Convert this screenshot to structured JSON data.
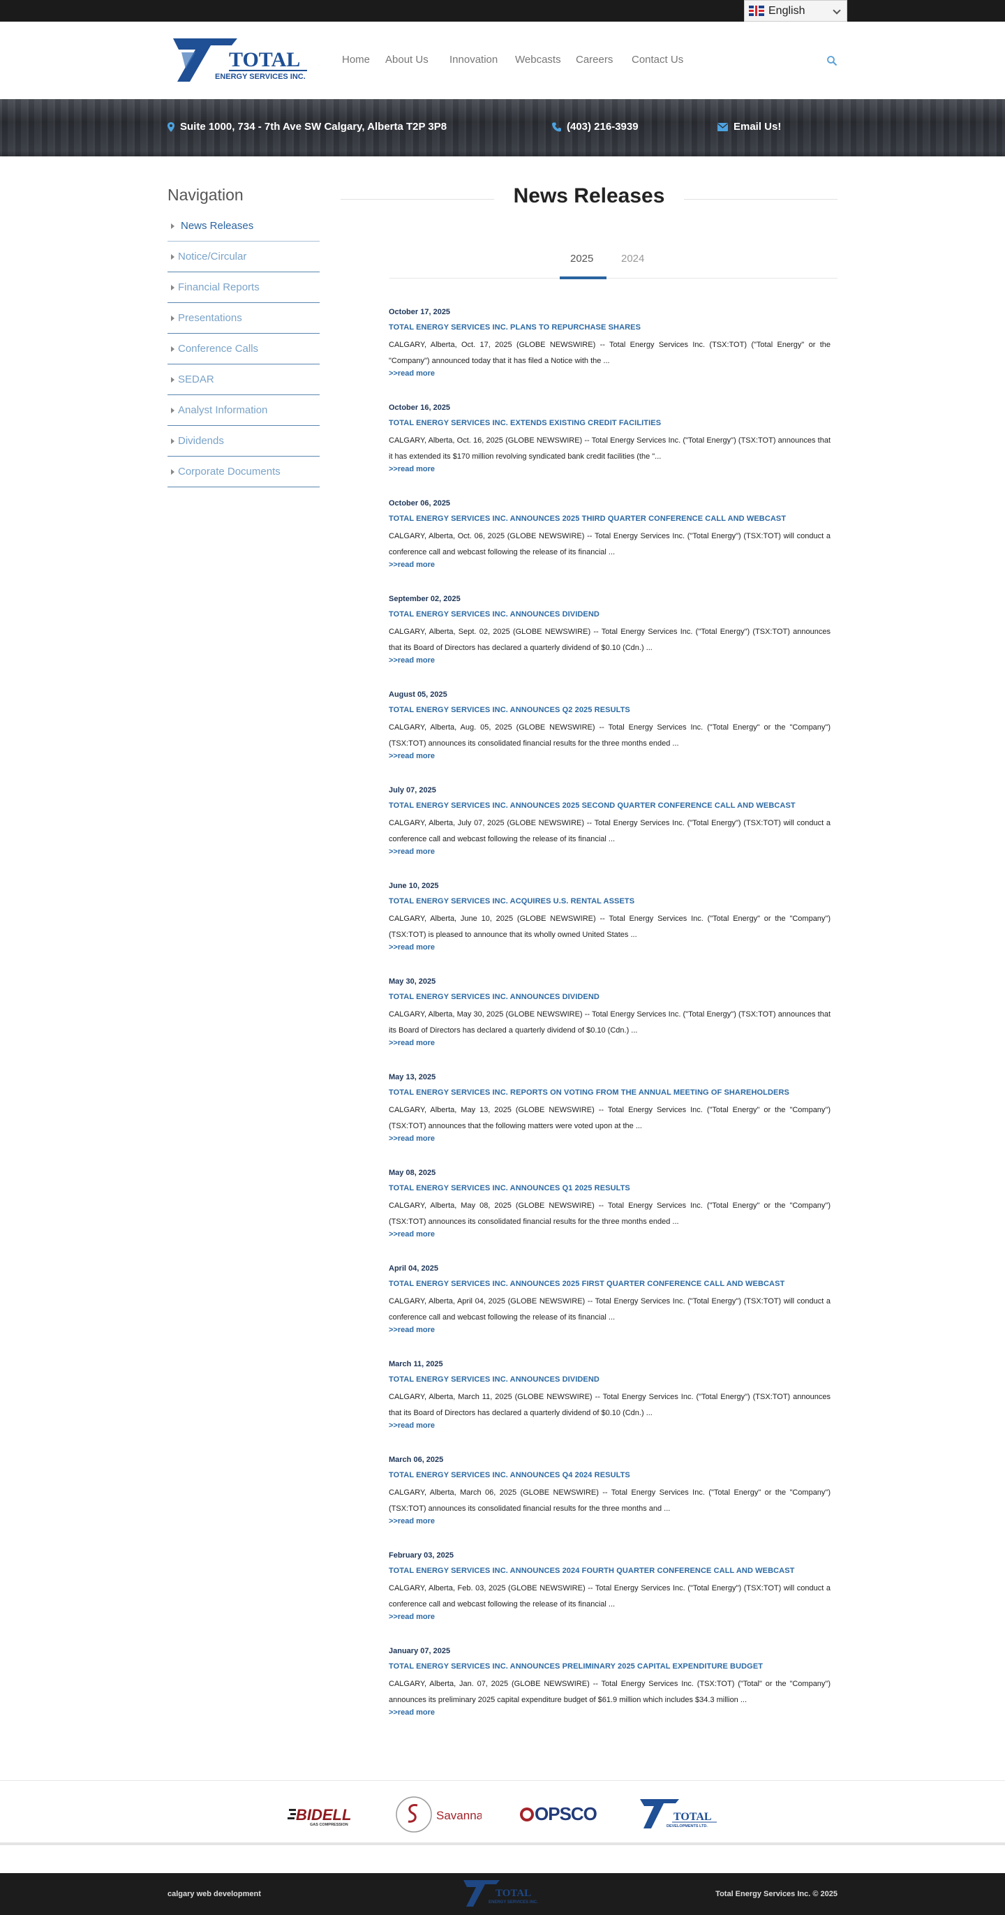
{
  "language_selector": {
    "label": "English",
    "flag_icon": "uk-flag-icon"
  },
  "header": {
    "logo_text": "TOTAL",
    "logo_subtext": "ENERGY SERVICES INC.",
    "nav": [
      "Home",
      "About Us",
      "Innovation",
      "Webcasts",
      "Careers",
      "Contact Us"
    ],
    "search_icon": "search-icon"
  },
  "contact": {
    "address": "Suite 1000, 734 - 7th Ave SW Calgary, Alberta T2P 3P8",
    "phone": "(403) 216-3939",
    "email_label": "Email Us!"
  },
  "sidebar": {
    "title": "Navigation",
    "items": [
      "News Releases",
      "Notice/Circular",
      "Financial Reports",
      "Presentations",
      "Conference Calls",
      "SEDAR",
      "Analyst Information",
      "Dividends",
      "Corporate Documents"
    ],
    "active_index": 0
  },
  "main": {
    "title": "News Releases",
    "tabs": [
      "2025",
      "2024"
    ],
    "active_tab": 0,
    "read_more_label": ">>read more",
    "news": [
      {
        "date": "October 17, 2025",
        "title": "TOTAL ENERGY SERVICES INC. PLANS TO REPURCHASE SHARES",
        "body": "CALGARY, Alberta, Oct. 17, 2025 (GLOBE NEWSWIRE) -- Total Energy Services Inc. (TSX:TOT) (\"Total Energy\" or the \"Company\") announced today that it has filed a Notice with the ..."
      },
      {
        "date": "October 16, 2025",
        "title": "TOTAL ENERGY SERVICES INC. EXTENDS EXISTING CREDIT FACILITIES",
        "body": "CALGARY, Alberta, Oct. 16, 2025 (GLOBE NEWSWIRE) -- Total Energy Services Inc. (\"Total Energy\") (TSX:TOT) announces that it has extended its $170 million revolving syndicated bank credit facilities (the \"..."
      },
      {
        "date": "October 06, 2025",
        "title": "TOTAL ENERGY SERVICES INC. ANNOUNCES 2025 THIRD QUARTER CONFERENCE CALL AND WEBCAST",
        "body": "CALGARY, Alberta, Oct. 06, 2025 (GLOBE NEWSWIRE) -- Total Energy Services Inc. (\"Total Energy\") (TSX:TOT) will conduct a conference call and webcast following the release of its financial ..."
      },
      {
        "date": "September 02, 2025",
        "title": "TOTAL ENERGY SERVICES INC. ANNOUNCES DIVIDEND",
        "body": "CALGARY, Alberta, Sept. 02, 2025 (GLOBE NEWSWIRE) -- Total Energy Services Inc. (\"Total Energy\") (TSX:TOT) announces that its Board of Directors has declared a quarterly dividend of $0.10 (Cdn.) ..."
      },
      {
        "date": "August 05, 2025",
        "title": "TOTAL ENERGY SERVICES INC. ANNOUNCES Q2 2025 RESULTS",
        "body": "CALGARY, Alberta, Aug. 05, 2025 (GLOBE NEWSWIRE) -- Total Energy Services Inc. (\"Total Energy\" or the \"Company\") (TSX:TOT) announces its consolidated financial results for the three months ended ..."
      },
      {
        "date": "July 07, 2025",
        "title": "TOTAL ENERGY SERVICES INC. ANNOUNCES 2025 SECOND QUARTER CONFERENCE CALL AND WEBCAST",
        "body": "CALGARY, Alberta, July 07, 2025 (GLOBE NEWSWIRE) -- Total Energy Services Inc. (\"Total Energy\") (TSX:TOT) will conduct a conference call and webcast following the release of its financial ..."
      },
      {
        "date": "June 10, 2025",
        "title": "TOTAL ENERGY SERVICES INC. ACQUIRES U.S. RENTAL ASSETS",
        "body": "CALGARY, Alberta, June 10, 2025 (GLOBE NEWSWIRE) -- Total Energy Services Inc. (\"Total Energy\" or the \"Company\") (TSX:TOT) is pleased to announce that its wholly owned United States ..."
      },
      {
        "date": "May 30, 2025",
        "title": "TOTAL ENERGY SERVICES INC. ANNOUNCES DIVIDEND",
        "body": "CALGARY, Alberta, May 30, 2025 (GLOBE NEWSWIRE) -- Total Energy Services Inc. (\"Total Energy\") (TSX:TOT) announces that its Board of Directors has declared a quarterly dividend of $0.10 (Cdn.) ..."
      },
      {
        "date": "May 13, 2025",
        "title": "TOTAL ENERGY SERVICES INC. REPORTS ON VOTING FROM THE ANNUAL MEETING OF SHAREHOLDERS",
        "body": "CALGARY, Alberta, May 13, 2025 (GLOBE NEWSWIRE) -- Total Energy Services Inc. (\"Total Energy\" or the \"Company\") (TSX:TOT) announces that the following matters were voted upon at the ..."
      },
      {
        "date": "May 08, 2025",
        "title": "TOTAL ENERGY SERVICES INC. ANNOUNCES Q1 2025 RESULTS",
        "body": "CALGARY, Alberta, May 08, 2025 (GLOBE NEWSWIRE) -- Total Energy Services Inc. (\"Total Energy\" or the \"Company\") (TSX:TOT) announces its consolidated financial results for the three months ended ..."
      },
      {
        "date": "April 04, 2025",
        "title": "TOTAL ENERGY SERVICES INC. ANNOUNCES 2025 FIRST QUARTER CONFERENCE CALL AND WEBCAST",
        "body": "CALGARY, Alberta, April 04, 2025 (GLOBE NEWSWIRE) -- Total Energy Services Inc. (\"Total Energy\") (TSX:TOT) will conduct a conference call and webcast following the release of its financial ..."
      },
      {
        "date": "March 11, 2025",
        "title": "TOTAL ENERGY SERVICES INC. ANNOUNCES DIVIDEND",
        "body": "CALGARY, Alberta, March 11, 2025 (GLOBE NEWSWIRE) -- Total Energy Services Inc. (\"Total Energy\") (TSX:TOT) announces that its Board of Directors has declared a quarterly dividend of $0.10 (Cdn.) ..."
      },
      {
        "date": "March 06, 2025",
        "title": "TOTAL ENERGY SERVICES INC. ANNOUNCES Q4 2024 RESULTS",
        "body": "CALGARY, Alberta, March 06, 2025 (GLOBE NEWSWIRE) -- Total Energy Services Inc. (\"Total Energy\" or the \"Company\") (TSX:TOT) announces its consolidated financial results for the three months and ..."
      },
      {
        "date": "February 03, 2025",
        "title": "TOTAL ENERGY SERVICES INC. ANNOUNCES 2024 FOURTH QUARTER CONFERENCE CALL AND WEBCAST",
        "body": "CALGARY, Alberta, Feb. 03, 2025 (GLOBE NEWSWIRE) -- Total Energy Services Inc. (\"Total Energy\") (TSX:TOT) will conduct a conference call and webcast following the release of its financial ..."
      },
      {
        "date": "January 07, 2025",
        "title": "TOTAL ENERGY SERVICES INC. ANNOUNCES PRELIMINARY 2025 CAPITAL EXPENDITURE BUDGET",
        "body": "CALGARY, Alberta, Jan. 07, 2025 (GLOBE NEWSWIRE) -- Total Energy Services Inc. (TSX:TOT) (\"Total\" or the \"Company\") announces its preliminary 2025 capital expenditure budget of $61.9 million which includes $34.3 million ..."
      }
    ]
  },
  "partners": {
    "bidell": {
      "name": "BIDELL",
      "sub": "GAS COMPRESSION"
    },
    "savanna": {
      "name": "Savanna"
    },
    "opsco": {
      "name": "OPSCO"
    },
    "total": {
      "name": "TOTAL",
      "sub": "DEVELOPMENTS LTD."
    }
  },
  "footer": {
    "left": "calgary web development",
    "right": "Total Energy Services Inc. © 2025",
    "logo_text": "TOTAL",
    "logo_subtext": "ENERGY SERVICES INC."
  },
  "colors": {
    "brand_blue": "#1f4f95",
    "link_blue": "#2d6aa3",
    "topbar": "#1b1b1b",
    "footer": "#1c1c1c"
  }
}
